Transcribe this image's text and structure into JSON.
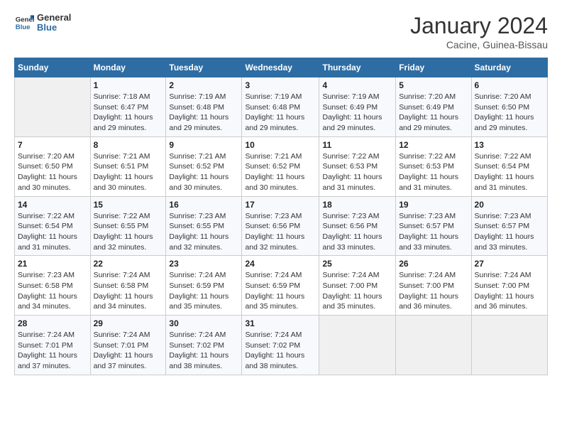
{
  "logo": {
    "line1": "General",
    "line2": "Blue"
  },
  "title": "January 2024",
  "subtitle": "Cacine, Guinea-Bissau",
  "days_header": [
    "Sunday",
    "Monday",
    "Tuesday",
    "Wednesday",
    "Thursday",
    "Friday",
    "Saturday"
  ],
  "weeks": [
    [
      {
        "num": "",
        "info": ""
      },
      {
        "num": "1",
        "info": "Sunrise: 7:18 AM\nSunset: 6:47 PM\nDaylight: 11 hours\nand 29 minutes."
      },
      {
        "num": "2",
        "info": "Sunrise: 7:19 AM\nSunset: 6:48 PM\nDaylight: 11 hours\nand 29 minutes."
      },
      {
        "num": "3",
        "info": "Sunrise: 7:19 AM\nSunset: 6:48 PM\nDaylight: 11 hours\nand 29 minutes."
      },
      {
        "num": "4",
        "info": "Sunrise: 7:19 AM\nSunset: 6:49 PM\nDaylight: 11 hours\nand 29 minutes."
      },
      {
        "num": "5",
        "info": "Sunrise: 7:20 AM\nSunset: 6:49 PM\nDaylight: 11 hours\nand 29 minutes."
      },
      {
        "num": "6",
        "info": "Sunrise: 7:20 AM\nSunset: 6:50 PM\nDaylight: 11 hours\nand 29 minutes."
      }
    ],
    [
      {
        "num": "7",
        "info": "Sunrise: 7:20 AM\nSunset: 6:50 PM\nDaylight: 11 hours\nand 30 minutes."
      },
      {
        "num": "8",
        "info": "Sunrise: 7:21 AM\nSunset: 6:51 PM\nDaylight: 11 hours\nand 30 minutes."
      },
      {
        "num": "9",
        "info": "Sunrise: 7:21 AM\nSunset: 6:52 PM\nDaylight: 11 hours\nand 30 minutes."
      },
      {
        "num": "10",
        "info": "Sunrise: 7:21 AM\nSunset: 6:52 PM\nDaylight: 11 hours\nand 30 minutes."
      },
      {
        "num": "11",
        "info": "Sunrise: 7:22 AM\nSunset: 6:53 PM\nDaylight: 11 hours\nand 31 minutes."
      },
      {
        "num": "12",
        "info": "Sunrise: 7:22 AM\nSunset: 6:53 PM\nDaylight: 11 hours\nand 31 minutes."
      },
      {
        "num": "13",
        "info": "Sunrise: 7:22 AM\nSunset: 6:54 PM\nDaylight: 11 hours\nand 31 minutes."
      }
    ],
    [
      {
        "num": "14",
        "info": "Sunrise: 7:22 AM\nSunset: 6:54 PM\nDaylight: 11 hours\nand 31 minutes."
      },
      {
        "num": "15",
        "info": "Sunrise: 7:22 AM\nSunset: 6:55 PM\nDaylight: 11 hours\nand 32 minutes."
      },
      {
        "num": "16",
        "info": "Sunrise: 7:23 AM\nSunset: 6:55 PM\nDaylight: 11 hours\nand 32 minutes."
      },
      {
        "num": "17",
        "info": "Sunrise: 7:23 AM\nSunset: 6:56 PM\nDaylight: 11 hours\nand 32 minutes."
      },
      {
        "num": "18",
        "info": "Sunrise: 7:23 AM\nSunset: 6:56 PM\nDaylight: 11 hours\nand 33 minutes."
      },
      {
        "num": "19",
        "info": "Sunrise: 7:23 AM\nSunset: 6:57 PM\nDaylight: 11 hours\nand 33 minutes."
      },
      {
        "num": "20",
        "info": "Sunrise: 7:23 AM\nSunset: 6:57 PM\nDaylight: 11 hours\nand 33 minutes."
      }
    ],
    [
      {
        "num": "21",
        "info": "Sunrise: 7:23 AM\nSunset: 6:58 PM\nDaylight: 11 hours\nand 34 minutes."
      },
      {
        "num": "22",
        "info": "Sunrise: 7:24 AM\nSunset: 6:58 PM\nDaylight: 11 hours\nand 34 minutes."
      },
      {
        "num": "23",
        "info": "Sunrise: 7:24 AM\nSunset: 6:59 PM\nDaylight: 11 hours\nand 35 minutes."
      },
      {
        "num": "24",
        "info": "Sunrise: 7:24 AM\nSunset: 6:59 PM\nDaylight: 11 hours\nand 35 minutes."
      },
      {
        "num": "25",
        "info": "Sunrise: 7:24 AM\nSunset: 7:00 PM\nDaylight: 11 hours\nand 35 minutes."
      },
      {
        "num": "26",
        "info": "Sunrise: 7:24 AM\nSunset: 7:00 PM\nDaylight: 11 hours\nand 36 minutes."
      },
      {
        "num": "27",
        "info": "Sunrise: 7:24 AM\nSunset: 7:00 PM\nDaylight: 11 hours\nand 36 minutes."
      }
    ],
    [
      {
        "num": "28",
        "info": "Sunrise: 7:24 AM\nSunset: 7:01 PM\nDaylight: 11 hours\nand 37 minutes."
      },
      {
        "num": "29",
        "info": "Sunrise: 7:24 AM\nSunset: 7:01 PM\nDaylight: 11 hours\nand 37 minutes."
      },
      {
        "num": "30",
        "info": "Sunrise: 7:24 AM\nSunset: 7:02 PM\nDaylight: 11 hours\nand 38 minutes."
      },
      {
        "num": "31",
        "info": "Sunrise: 7:24 AM\nSunset: 7:02 PM\nDaylight: 11 hours\nand 38 minutes."
      },
      {
        "num": "",
        "info": ""
      },
      {
        "num": "",
        "info": ""
      },
      {
        "num": "",
        "info": ""
      }
    ]
  ]
}
